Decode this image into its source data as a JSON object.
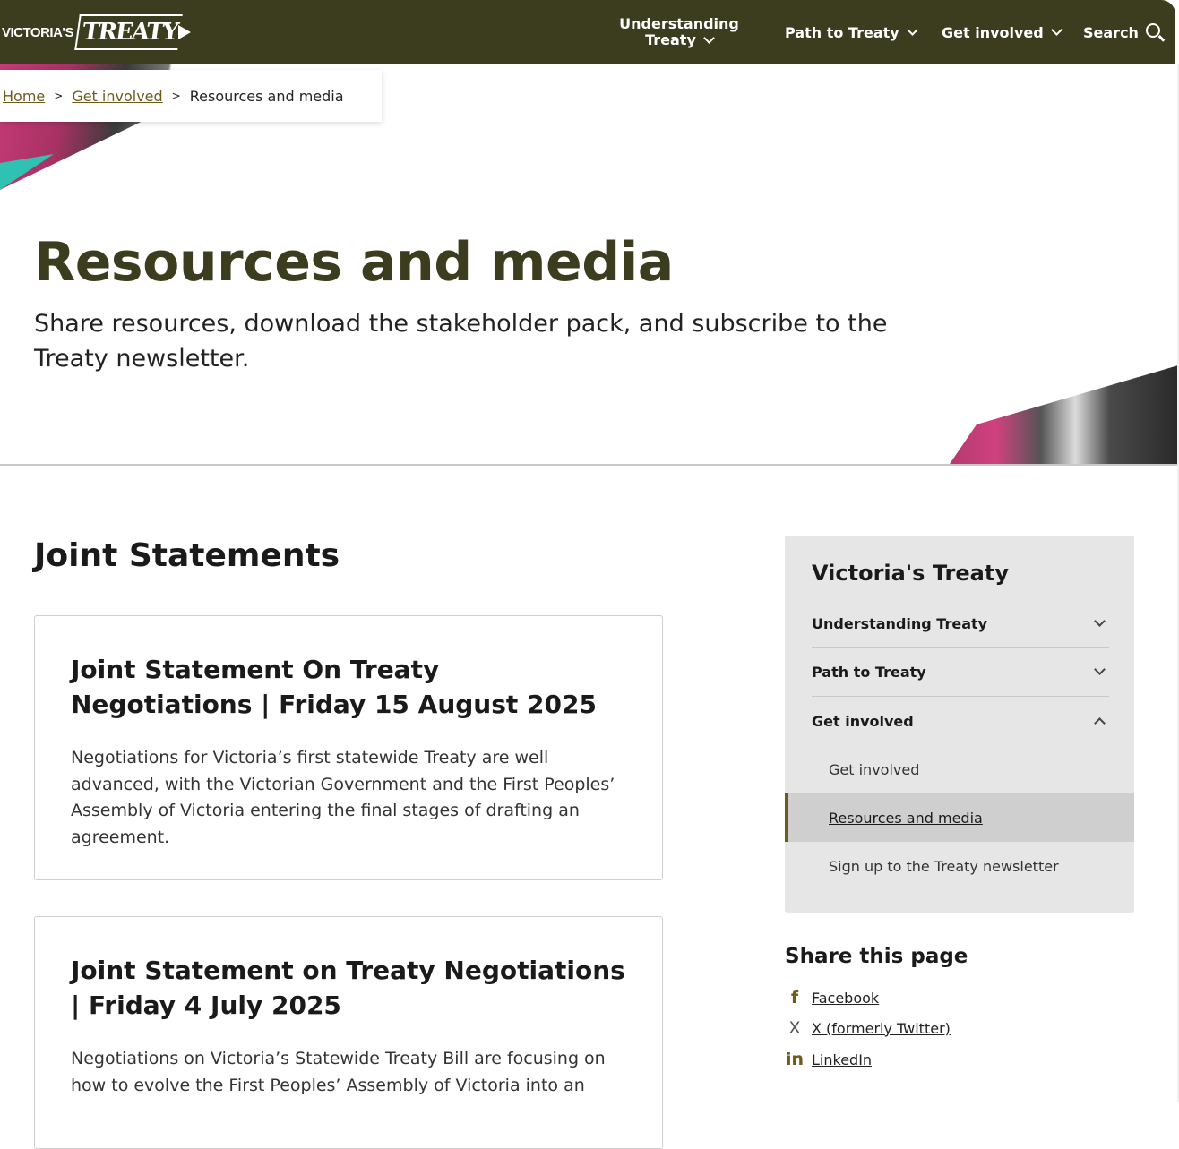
{
  "header": {
    "logo_small": "VICTORIA'S",
    "logo_big": "TREATY",
    "nav": {
      "understanding_line1": "Understanding",
      "understanding_line2": "Treaty",
      "path": "Path to Treaty",
      "get_involved": "Get involved",
      "search": "Search"
    }
  },
  "breadcrumb": {
    "home": "Home",
    "sep": ">",
    "get_involved": "Get involved",
    "current": "Resources and media"
  },
  "hero": {
    "title": "Resources and media",
    "intro": "Share resources, download the stakeholder pack, and subscribe to the Treaty newsletter."
  },
  "main": {
    "section_title": "Joint Statements",
    "cards": [
      {
        "title": "Joint Statement On Treaty Negotiations | Friday 15 August 2025",
        "body": "Negotiations for Victoria’s first statewide Treaty are well advanced, with the Victorian Government and the First Peoples’ Assembly of Victoria entering the final stages of drafting an agreement."
      },
      {
        "title": "Joint Statement on Treaty Negotiations | Friday 4 July 2025",
        "body": "Negotiations on Victoria’s Statewide Treaty Bill are focusing on how to evolve the First Peoples’ Assembly of Victoria into an"
      }
    ]
  },
  "sidebar": {
    "title": "Victoria's Treaty",
    "items": [
      {
        "label": "Understanding Treaty"
      },
      {
        "label": "Path to Treaty"
      },
      {
        "label": "Get involved"
      }
    ],
    "subitems": [
      {
        "label": "Get involved"
      },
      {
        "label": "Resources and media"
      },
      {
        "label": "Sign up to the Treaty newsletter"
      }
    ],
    "share": {
      "title": "Share this page",
      "facebook": "Facebook",
      "x": "X (formerly Twitter)",
      "linkedin": "LinkedIn"
    }
  },
  "icons": {
    "facebook": "f",
    "x": "X",
    "linkedin": "in"
  },
  "colors": {
    "brand_dark": "#3b3d1e",
    "accent_gold": "#6d5a1d",
    "sidebar_bg": "#e6e6e6"
  }
}
